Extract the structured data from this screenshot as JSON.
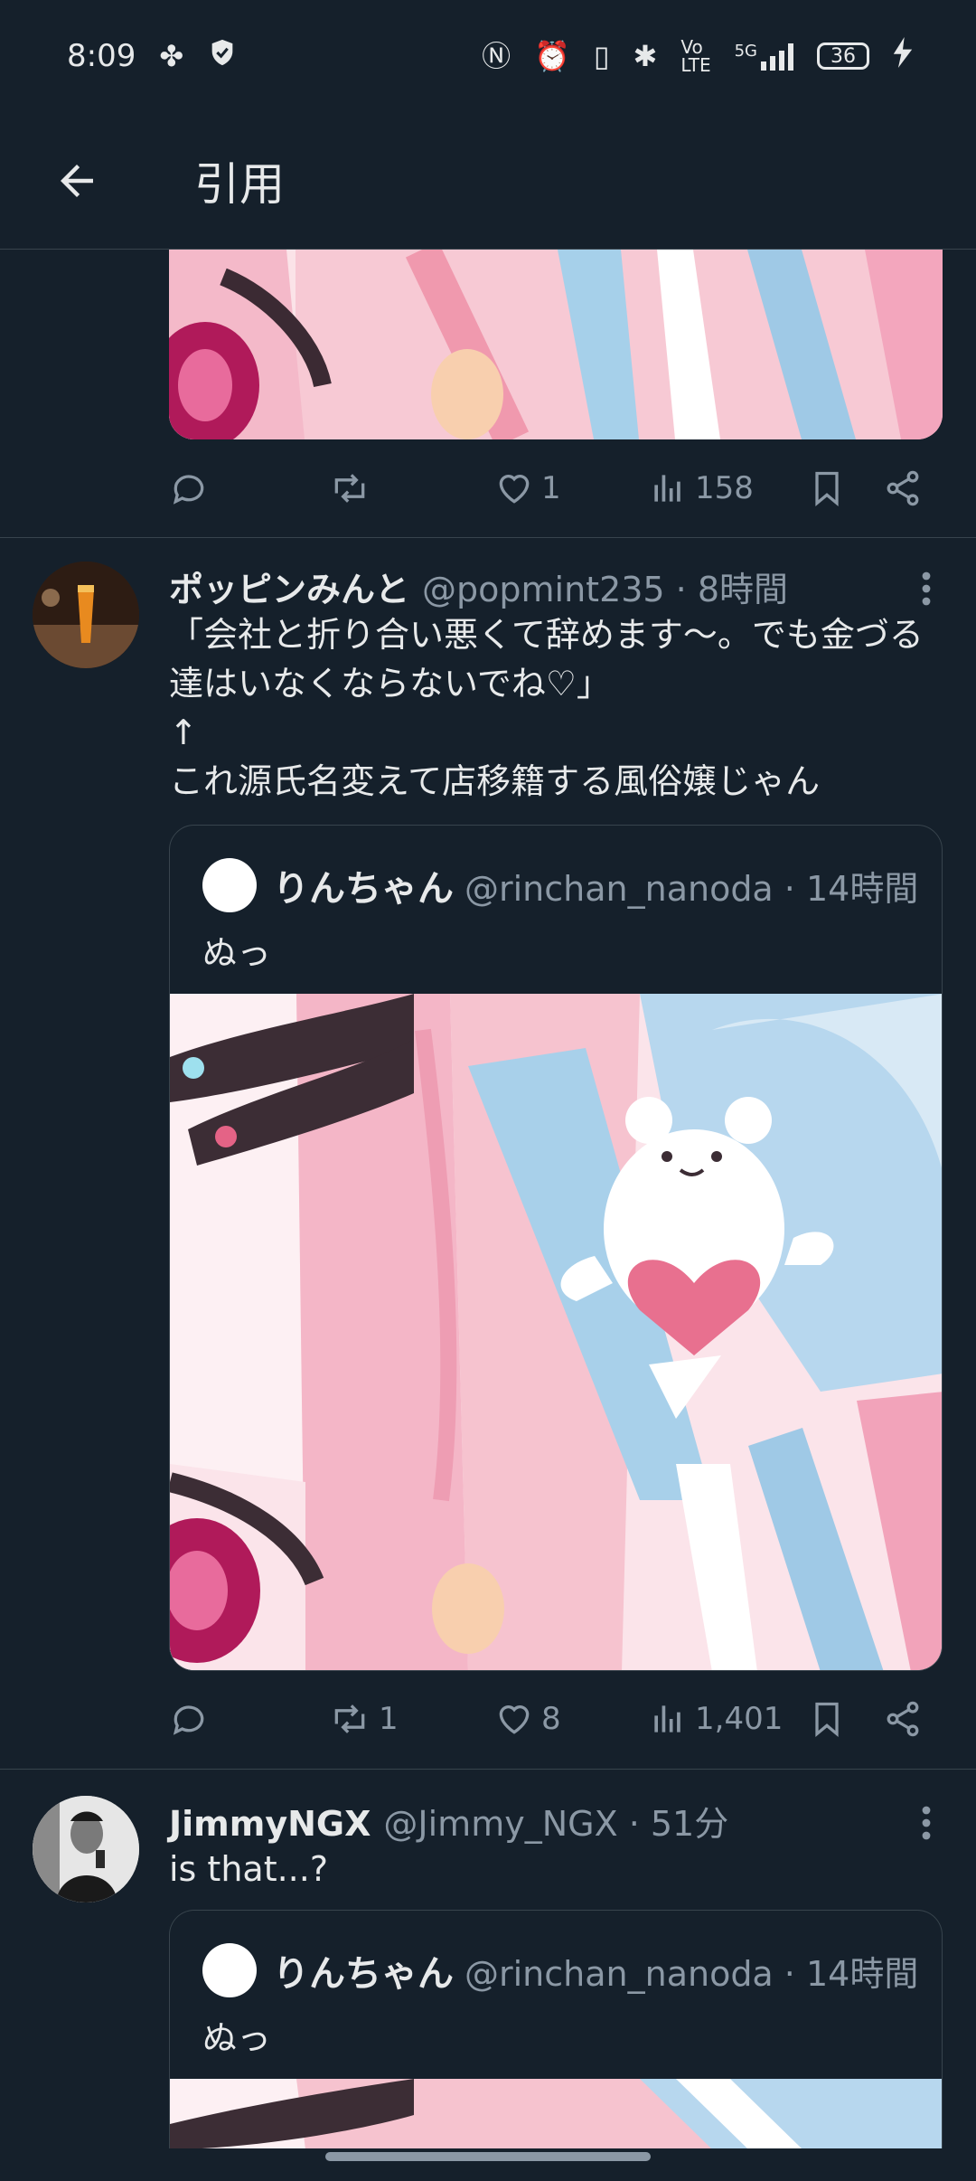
{
  "status_bar": {
    "time": "8:09",
    "battery": "36",
    "network": "5G"
  },
  "header": {
    "title": "引用"
  },
  "top_actions": {
    "reply": "",
    "retweet": "",
    "like": "1",
    "views": "158"
  },
  "tweets": [
    {
      "name": "ポッピンみんと",
      "handle": "@popmint235 · 8時間",
      "text": "「会社と折り合い悪くて辞めます〜。でも金づる達はいなくならないでね♡」\n↑\nこれ源氏名変えて店移籍する風俗嬢じゃん",
      "quote": {
        "name": "りんちゃん",
        "handle": "@rinchan_nanoda · 14時間",
        "text": "ぬっ"
      },
      "actions": {
        "reply": "",
        "retweet": "1",
        "like": "8",
        "views": "1,401"
      }
    },
    {
      "name": "JimmyNGX",
      "handle": "@Jimmy_NGX · 51分",
      "text": "is that...?",
      "quote": {
        "name": "りんちゃん",
        "handle": "@rinchan_nanoda · 14時間",
        "text": "ぬっ"
      }
    }
  ],
  "colors": {
    "background": "#15202b",
    "text": "#e7e9ea",
    "secondary": "#8b98a5",
    "border": "#38444d"
  }
}
